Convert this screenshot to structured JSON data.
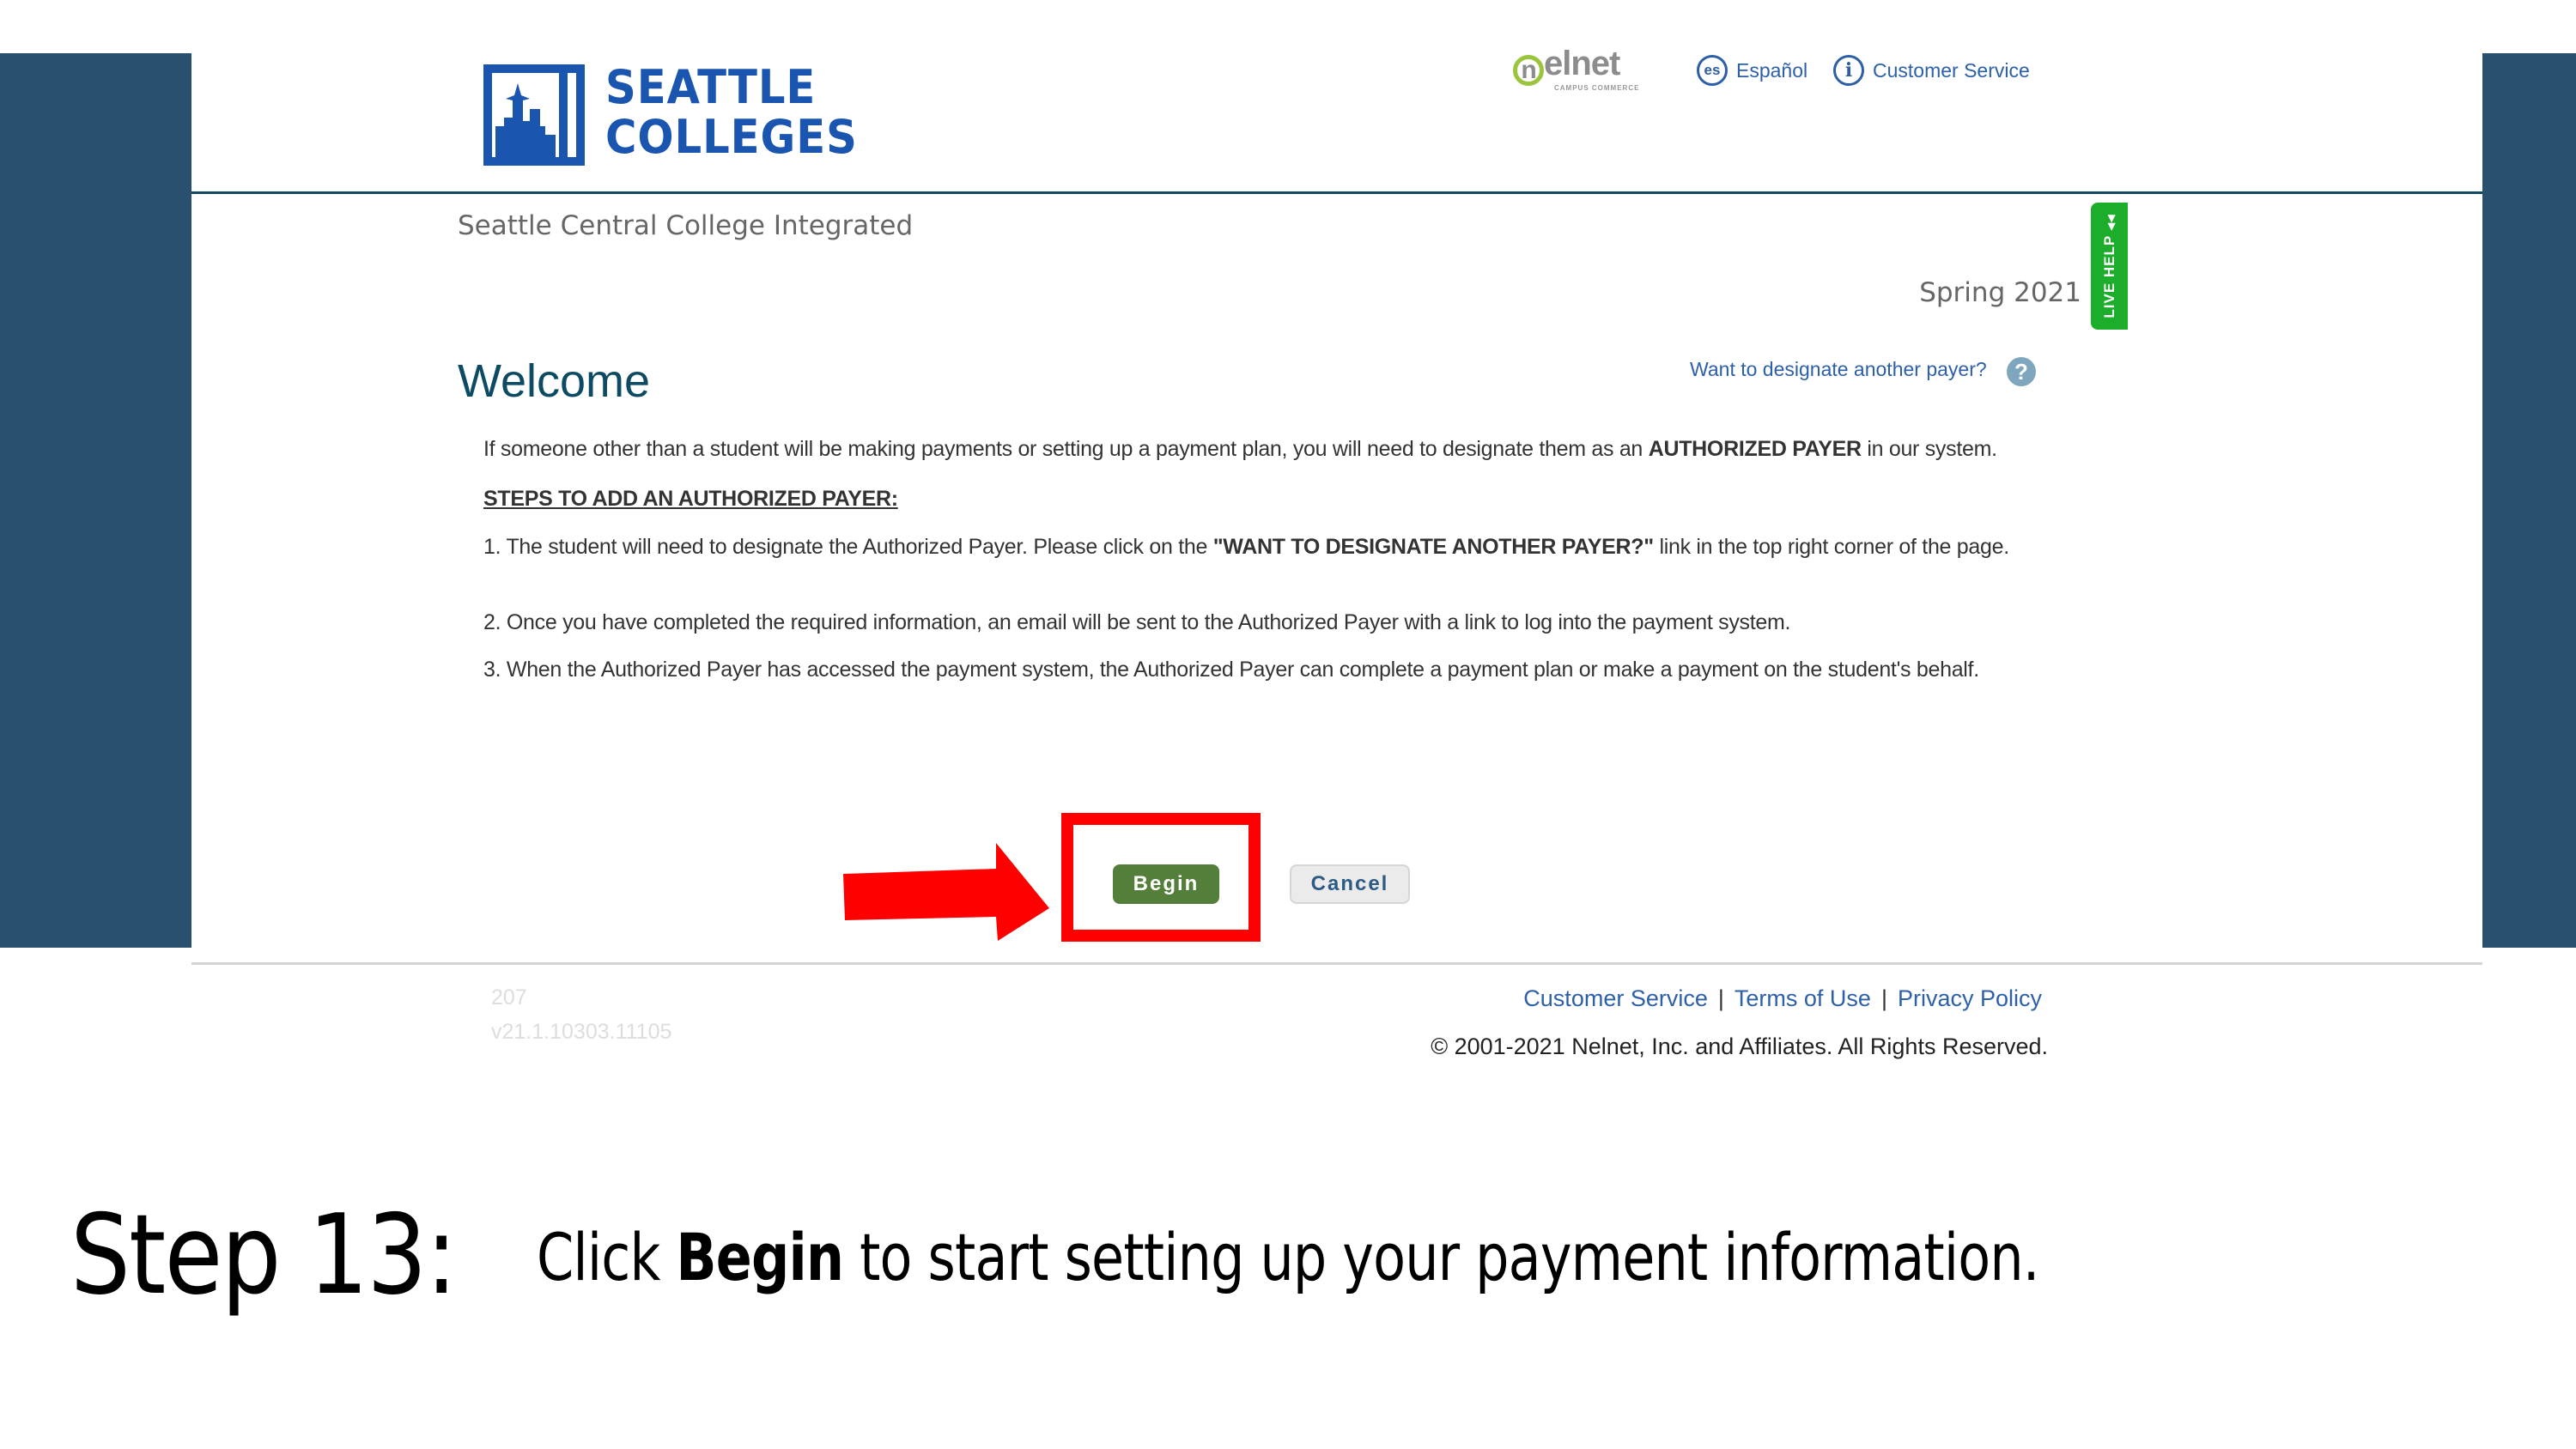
{
  "header": {
    "logo": {
      "line1": "SEATTLE",
      "line2": "COLLEGES",
      "color": "#1a56b0"
    },
    "partner_logo": {
      "word": "elnet",
      "ring_letter": "n",
      "subtitle": "CAMPUS COMMERCE"
    },
    "links": [
      {
        "icon": "es",
        "label": "Español"
      },
      {
        "icon": "i",
        "label": "Customer Service"
      }
    ]
  },
  "institution": "Seattle Central College Integrated",
  "term": "Spring 2021",
  "live_help": {
    "label": "LIVE HELP",
    "color": "#1cae2b"
  },
  "main": {
    "title": "Welcome",
    "designate_link": "Want to designate another payer?",
    "help_icon": "?",
    "intro": {
      "before": "If someone other than a student will be making payments or setting up a payment plan, you will need to designate them as an ",
      "bold": "AUTHORIZED PAYER",
      "after": " in our system."
    },
    "steps_heading": "STEPS TO ADD AN AUTHORIZED PAYER:",
    "steps": [
      {
        "before": "1. The student will need to designate the Authorized Payer. Please click on the ",
        "bold": "\"WANT TO DESIGNATE ANOTHER PAYER?\"",
        "after": " link in the top right corner of the page."
      },
      {
        "text": "2. Once you have completed the required information, an email will be sent to the Authorized Payer with a link to log into the payment system."
      },
      {
        "text": "3. When the Authorized Payer has accessed the payment system, the Authorized Payer can complete a payment plan or make a payment on the student's behalf."
      }
    ],
    "buttons": {
      "begin": "Begin",
      "cancel": "Cancel"
    }
  },
  "annotation": {
    "highlight_color": "#ff0000",
    "arrow_color": "#ff0000"
  },
  "footer": {
    "page_number": "207",
    "version": "v21.1.10303.11105",
    "links": [
      "Customer Service",
      "Terms of Use",
      "Privacy Policy"
    ],
    "separator": "|",
    "copyright": "© 2001-2021 Nelnet, Inc. and Affiliates. All Rights Reserved."
  },
  "instruction": {
    "step_label": "Step 13:",
    "caption_before": "Click ",
    "caption_bold": "Begin",
    "caption_after": " to start setting up your payment information."
  },
  "colors": {
    "side_panel": "#2a5070",
    "heading": "#0d4a63",
    "link": "#2d60a8",
    "begin_button": "#537f3a"
  }
}
